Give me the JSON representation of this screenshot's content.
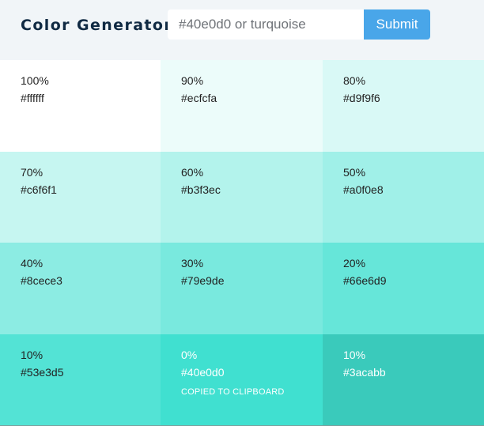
{
  "header": {
    "title": "Color Generator",
    "input_placeholder": "#40e0d0 or turquoise",
    "input_value": "",
    "submit_label": "Submit"
  },
  "swatches": [
    {
      "percent": "100%",
      "hex": "#ffffff",
      "bg": "#ffffff",
      "dark": false,
      "alert": ""
    },
    {
      "percent": "90%",
      "hex": "#ecfcfa",
      "bg": "#ecfcfa",
      "dark": false,
      "alert": ""
    },
    {
      "percent": "80%",
      "hex": "#d9f9f6",
      "bg": "#d9f9f6",
      "dark": false,
      "alert": ""
    },
    {
      "percent": "70%",
      "hex": "#c6f6f1",
      "bg": "#c6f6f1",
      "dark": false,
      "alert": ""
    },
    {
      "percent": "60%",
      "hex": "#b3f3ec",
      "bg": "#b3f3ec",
      "dark": false,
      "alert": ""
    },
    {
      "percent": "50%",
      "hex": "#a0f0e8",
      "bg": "#a0f0e8",
      "dark": false,
      "alert": ""
    },
    {
      "percent": "40%",
      "hex": "#8cece3",
      "bg": "#8cece3",
      "dark": false,
      "alert": ""
    },
    {
      "percent": "30%",
      "hex": "#79e9de",
      "bg": "#79e9de",
      "dark": false,
      "alert": ""
    },
    {
      "percent": "20%",
      "hex": "#66e6d9",
      "bg": "#66e6d9",
      "dark": false,
      "alert": ""
    },
    {
      "percent": "10%",
      "hex": "#53e3d5",
      "bg": "#53e3d5",
      "dark": false,
      "alert": ""
    },
    {
      "percent": "0%",
      "hex": "#40e0d0",
      "bg": "#40e0d0",
      "dark": true,
      "alert": "copied to clipboard"
    },
    {
      "percent": "10%",
      "hex": "#3acabb",
      "bg": "#3acabb",
      "dark": true,
      "alert": ""
    }
  ]
}
